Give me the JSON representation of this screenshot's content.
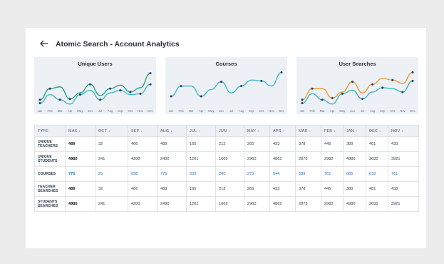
{
  "header": {
    "title": "Atomic Search - Account Analytics",
    "back_icon": "arrow-left-icon"
  },
  "charts": [
    {
      "title": "Unique Users",
      "months": [
        "Jan",
        "Feb",
        "Mar",
        "Apr",
        "May",
        "Jun",
        "Jul",
        "Aug",
        "Sep",
        "Oct",
        "Nov",
        "Dec"
      ],
      "series": [
        {
          "color": "#1fa37a",
          "values": [
            12,
            38,
            42,
            14,
            28,
            48,
            22,
            38,
            46,
            30,
            40,
            74
          ]
        },
        {
          "color": "#3fb8c8",
          "values": [
            4,
            24,
            12,
            2,
            24,
            34,
            12,
            28,
            34,
            24,
            26,
            48
          ]
        }
      ]
    },
    {
      "title": "Courses",
      "months": [
        "Jan",
        "Feb",
        "Mar",
        "Apr",
        "May",
        "Jun",
        "Jul",
        "Aug",
        "Sep",
        "Oct",
        "Nov",
        "Dec"
      ],
      "series": [
        {
          "color": "#3fb8c8",
          "values": [
            20,
            44,
            44,
            20,
            36,
            54,
            28,
            44,
            58,
            56,
            44,
            76
          ]
        }
      ]
    },
    {
      "title": "User Searches",
      "months": [
        "Jan",
        "Feb",
        "Mar",
        "Apr",
        "May",
        "Jun",
        "Jul",
        "Aug",
        "Sep",
        "Oct",
        "Nov",
        "Dec"
      ],
      "series": [
        {
          "color": "#f29c2b",
          "values": [
            12,
            38,
            38,
            16,
            30,
            54,
            28,
            48,
            62,
            58,
            50,
            76
          ]
        },
        {
          "color": "#3fb8c8",
          "values": [
            4,
            26,
            12,
            2,
            26,
            34,
            14,
            30,
            40,
            38,
            30,
            56
          ]
        }
      ]
    }
  ],
  "table": {
    "columns": [
      "TYPE",
      "MAX",
      "OCT",
      "SEP",
      "AUG",
      "JUL",
      "JUN",
      "MAY",
      "APR",
      "MAR",
      "FEB",
      "JAN",
      "DEC",
      "NOV"
    ],
    "sort_icon": "sort-updown-icon",
    "rows": [
      {
        "type": "UNIQUE TEACHERS",
        "cells": [
          "489",
          "32",
          "466",
          "489",
          "165",
          "213",
          "265",
          "423",
          "378",
          "445",
          "389",
          "401",
          "433"
        ]
      },
      {
        "type": "UNIQUE STUDENTS",
        "cells": [
          "4980",
          "241",
          "4200",
          "2490",
          "1201",
          "1669",
          "2960",
          "4862",
          "2875",
          "2982",
          "4980",
          "3032",
          "3921"
        ]
      },
      {
        "type": "COURSES",
        "cells": [
          "775",
          "25",
          "698",
          "775",
          "203",
          "245",
          "273",
          "544",
          "589",
          "761",
          "805",
          "632",
          "761"
        ],
        "accent": true
      },
      {
        "type": "TEACHER SEARCHES",
        "cells": [
          "489",
          "32",
          "466",
          "489",
          "165",
          "213",
          "265",
          "423",
          "378",
          "445",
          "389",
          "401",
          "433"
        ]
      },
      {
        "type": "STUDENTS SEARCHES",
        "cells": [
          "4980",
          "241",
          "4200",
          "2490",
          "1201",
          "1669",
          "2960",
          "4862",
          "2875",
          "2982",
          "4980",
          "3032",
          "3921"
        ]
      }
    ]
  }
}
